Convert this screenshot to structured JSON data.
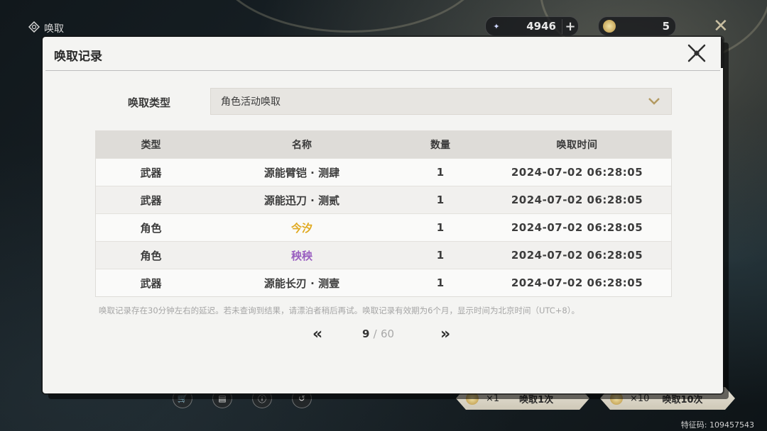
{
  "screen": {
    "title": "唤取",
    "feature_code": "特征码: 109457543"
  },
  "currencies": [
    {
      "icon": "astrite-icon",
      "amount": "4946",
      "has_plus": true
    },
    {
      "icon": "lustrous-tide-icon",
      "amount": "5",
      "has_plus": false
    }
  ],
  "bottom_bar": {
    "pull_one": {
      "count": "×1",
      "label": "唤取1次"
    },
    "pull_ten": {
      "count": "×10",
      "label": "唤取10次"
    }
  },
  "modal": {
    "title": "唤取记录",
    "type_label": "唤取类型",
    "type_value": "角色活动唤取",
    "columns": [
      "类型",
      "名称",
      "数量",
      "唤取时间"
    ],
    "records": [
      {
        "type": "武器",
        "name": "源能臂铠 · 测肆",
        "qty": "1",
        "time": "2024-07-02 06:28:05",
        "rarity": "3"
      },
      {
        "type": "武器",
        "name": "源能迅刀 · 测贰",
        "qty": "1",
        "time": "2024-07-02 06:28:05",
        "rarity": "3"
      },
      {
        "type": "角色",
        "name": "今汐",
        "qty": "1",
        "time": "2024-07-02 06:28:05",
        "rarity": "5"
      },
      {
        "type": "角色",
        "name": "秧秧",
        "qty": "1",
        "time": "2024-07-02 06:28:05",
        "rarity": "4"
      },
      {
        "type": "武器",
        "name": "源能长刃 · 测壹",
        "qty": "1",
        "time": "2024-07-02 06:28:05",
        "rarity": "3"
      }
    ],
    "note": "唤取记录存在30分钟左右的延迟。若未查询到结果，请漂泊者稍后再试。唤取记录有效期为6个月，显示时间为北京时间（UTC+8）。",
    "pagination": {
      "current": "9",
      "separator": "/",
      "total": "60"
    }
  },
  "colors": {
    "rarity_5": "#e0a91f",
    "rarity_4": "#9a5fc0",
    "rarity_3": "#3c3c3c"
  }
}
